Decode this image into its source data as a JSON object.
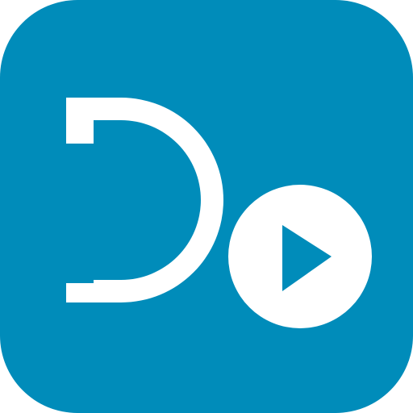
{
  "icon": {
    "name": "app-logo",
    "background_color": "#008CBA",
    "foreground_color": "#FFFFFF",
    "glyphs": {
      "letter": "d-shape-icon",
      "badge": "play-circle-icon"
    }
  }
}
